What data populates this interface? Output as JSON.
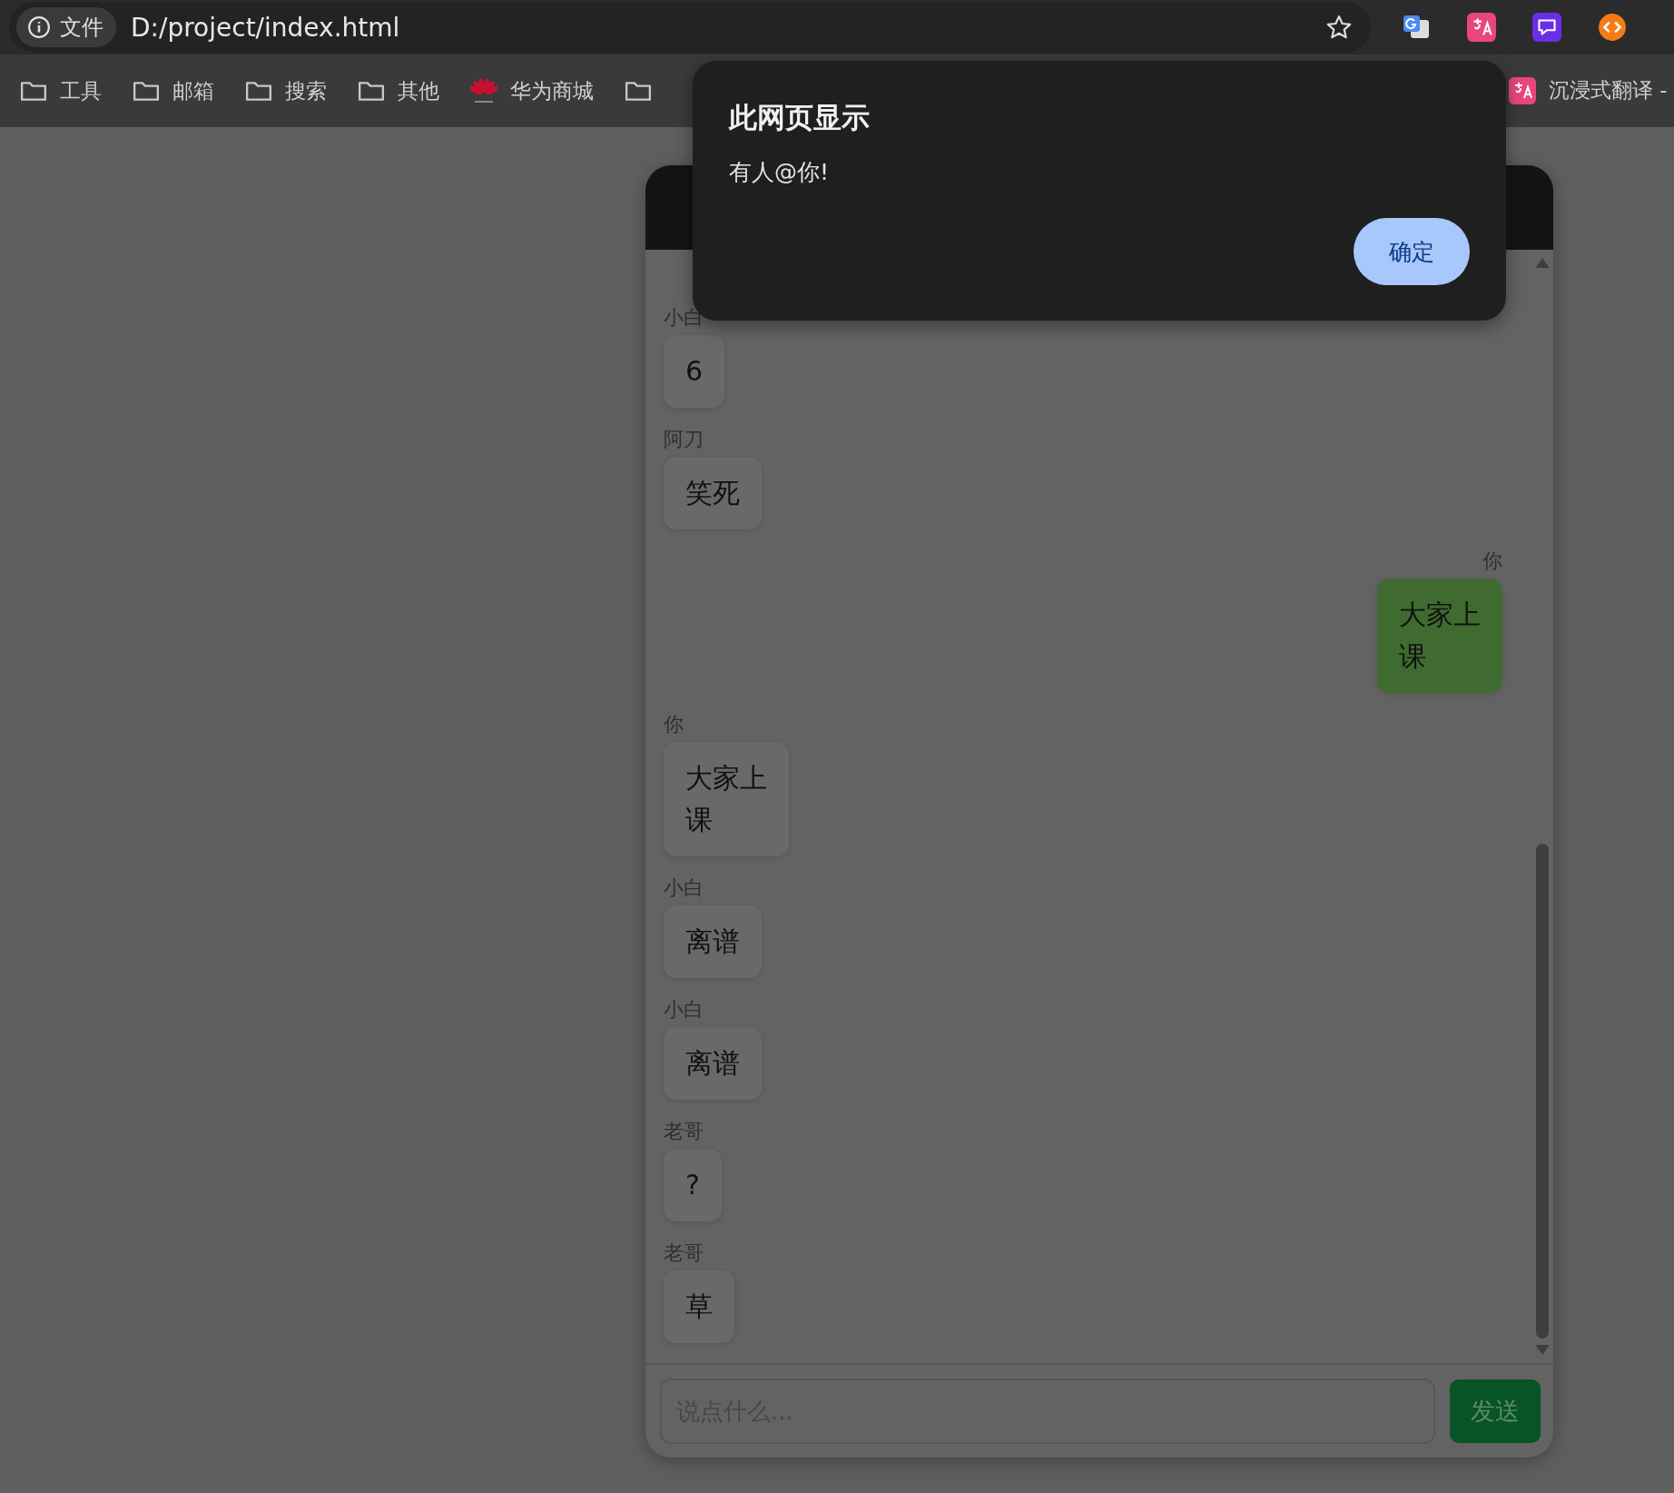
{
  "browser": {
    "site_info": "文件",
    "url": "D:/project/index.html",
    "bookmarks": [
      {
        "kind": "folder",
        "label": "工具"
      },
      {
        "kind": "folder",
        "label": "邮箱"
      },
      {
        "kind": "folder",
        "label": "搜索"
      },
      {
        "kind": "folder",
        "label": "其他"
      },
      {
        "kind": "site",
        "label": "华为商城"
      },
      {
        "kind": "folder"
      }
    ],
    "pinned_bookmark": {
      "kind": "extension",
      "label": "沉浸式翻译 -"
    }
  },
  "dialog": {
    "title": "此网页显示",
    "message": "有人@你!",
    "button": "确定"
  },
  "chat": {
    "messages": [
      {
        "sender": "小白",
        "text": "6",
        "kind": "received"
      },
      {
        "sender": "阿刀",
        "text": "笑死",
        "kind": "received"
      },
      {
        "sender": "你",
        "text": "大家上课",
        "kind": "sent"
      },
      {
        "sender": "你",
        "text": "大家上课",
        "kind": "received"
      },
      {
        "sender": "小白",
        "text": "离谱",
        "kind": "received"
      },
      {
        "sender": "小白",
        "text": "离谱",
        "kind": "received"
      },
      {
        "sender": "老哥",
        "text": "?",
        "kind": "received"
      },
      {
        "sender": "老哥",
        "text": "草",
        "kind": "received"
      }
    ],
    "input": {
      "placeholder": "说点什么..."
    },
    "send_button": "发送"
  }
}
